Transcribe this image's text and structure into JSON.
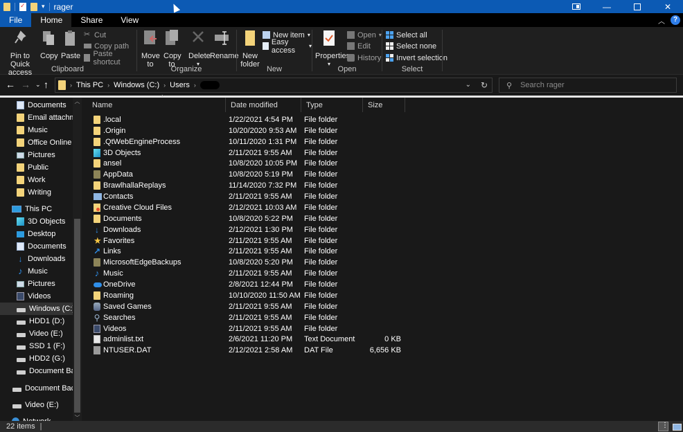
{
  "window": {
    "title": "rager",
    "controls": [
      "snap",
      "minimize",
      "maximize",
      "close"
    ]
  },
  "ribbon_tabs": [
    {
      "label": "File",
      "active": false
    },
    {
      "label": "Home",
      "active": true
    },
    {
      "label": "Share",
      "active": false
    },
    {
      "label": "View",
      "active": false
    }
  ],
  "ribbon": {
    "clipboard": {
      "label": "Clipboard",
      "pin": "Pin to Quick access",
      "pin_line1": "Pin to Quick",
      "pin_line2": "access",
      "copy": "Copy",
      "paste": "Paste",
      "cut": "Cut",
      "copy_path": "Copy path",
      "paste_shortcut": "Paste shortcut"
    },
    "organize": {
      "label": "Organize",
      "move_line1": "Move",
      "move_line2": "to",
      "copy_line1": "Copy",
      "copy_line2": "to",
      "delete": "Delete",
      "rename": "Rename"
    },
    "new": {
      "label": "New",
      "new_folder_line1": "New",
      "new_folder_line2": "folder",
      "new_item": "New item",
      "easy_access": "Easy access"
    },
    "open": {
      "label": "Open",
      "properties": "Properties",
      "open": "Open",
      "edit": "Edit",
      "history": "History"
    },
    "select": {
      "label": "Select",
      "select_all": "Select all",
      "select_none": "Select none",
      "invert_selection": "Invert selection"
    }
  },
  "address": {
    "breadcrumbs": [
      "This PC",
      "Windows (C:)",
      "Users"
    ],
    "search_placeholder": "Search rager"
  },
  "nav_pane": {
    "items": [
      {
        "label": "Documents",
        "icon": "documents"
      },
      {
        "label": "Email attachmer",
        "icon": "folder"
      },
      {
        "label": "Music",
        "icon": "folder"
      },
      {
        "label": "Office Online ex",
        "icon": "folder"
      },
      {
        "label": "Pictures",
        "icon": "pictures"
      },
      {
        "label": "Public",
        "icon": "folder"
      },
      {
        "label": "Work",
        "icon": "folder"
      },
      {
        "label": "Writing",
        "icon": "folder"
      },
      {
        "label": "This PC",
        "icon": "pc"
      },
      {
        "label": "3D Objects",
        "icon": "3d"
      },
      {
        "label": "Desktop",
        "icon": "desktop"
      },
      {
        "label": "Documents",
        "icon": "documents"
      },
      {
        "label": "Downloads",
        "icon": "downloads"
      },
      {
        "label": "Music",
        "icon": "music"
      },
      {
        "label": "Pictures",
        "icon": "pictures"
      },
      {
        "label": "Videos",
        "icon": "videos"
      },
      {
        "label": "Windows (C:)",
        "icon": "drive",
        "selected": true
      },
      {
        "label": "HDD1 (D:)",
        "icon": "drive"
      },
      {
        "label": "Video (E:)",
        "icon": "drive"
      },
      {
        "label": "SSD 1 (F:)",
        "icon": "drive"
      },
      {
        "label": "HDD2 (G:)",
        "icon": "drive"
      },
      {
        "label": "Document Back",
        "icon": "drive"
      },
      {
        "label": "Document Back U",
        "icon": "drive"
      },
      {
        "label": "Video (E:)",
        "icon": "drive"
      },
      {
        "label": "Network",
        "icon": "network"
      }
    ]
  },
  "file_list": {
    "columns": [
      "Name",
      "Date modified",
      "Type",
      "Size"
    ],
    "rows": [
      {
        "name": ".local",
        "date": "1/22/2021 4:54 PM",
        "type": "File folder",
        "size": "",
        "icon": "folder"
      },
      {
        "name": ".Origin",
        "date": "10/20/2020 9:53 AM",
        "type": "File folder",
        "size": "",
        "icon": "folder"
      },
      {
        "name": ".QtWebEngineProcess",
        "date": "10/11/2020 1:31 PM",
        "type": "File folder",
        "size": "",
        "icon": "folder"
      },
      {
        "name": "3D Objects",
        "date": "2/11/2021 9:55 AM",
        "type": "File folder",
        "size": "",
        "icon": "3d"
      },
      {
        "name": "ansel",
        "date": "10/8/2020 10:05 PM",
        "type": "File folder",
        "size": "",
        "icon": "folder"
      },
      {
        "name": "AppData",
        "date": "10/8/2020 5:19 PM",
        "type": "File folder",
        "size": "",
        "icon": "folder-hidden"
      },
      {
        "name": "BrawlhallaReplays",
        "date": "11/14/2020 7:32 PM",
        "type": "File folder",
        "size": "",
        "icon": "folder"
      },
      {
        "name": "Contacts",
        "date": "2/11/2021 9:55 AM",
        "type": "File folder",
        "size": "",
        "icon": "contacts"
      },
      {
        "name": "Creative Cloud Files",
        "date": "2/12/2021 10:03 AM",
        "type": "File folder",
        "size": "",
        "icon": "creative-cloud"
      },
      {
        "name": "Documents",
        "date": "10/8/2020 5:22 PM",
        "type": "File folder",
        "size": "",
        "icon": "folder"
      },
      {
        "name": "Downloads",
        "date": "2/12/2021 1:30 PM",
        "type": "File folder",
        "size": "",
        "icon": "downloads"
      },
      {
        "name": "Favorites",
        "date": "2/11/2021 9:55 AM",
        "type": "File folder",
        "size": "",
        "icon": "favorites"
      },
      {
        "name": "Links",
        "date": "2/11/2021 9:55 AM",
        "type": "File folder",
        "size": "",
        "icon": "links"
      },
      {
        "name": "MicrosoftEdgeBackups",
        "date": "10/8/2020 5:20 PM",
        "type": "File folder",
        "size": "",
        "icon": "folder-hidden"
      },
      {
        "name": "Music",
        "date": "2/11/2021 9:55 AM",
        "type": "File folder",
        "size": "",
        "icon": "music"
      },
      {
        "name": "OneDrive",
        "date": "2/8/2021 12:44 PM",
        "type": "File folder",
        "size": "",
        "icon": "onedrive"
      },
      {
        "name": "Roaming",
        "date": "10/10/2020 11:50 AM",
        "type": "File folder",
        "size": "",
        "icon": "folder"
      },
      {
        "name": "Saved Games",
        "date": "2/11/2021 9:55 AM",
        "type": "File folder",
        "size": "",
        "icon": "saved-games"
      },
      {
        "name": "Searches",
        "date": "2/11/2021 9:55 AM",
        "type": "File folder",
        "size": "",
        "icon": "searches"
      },
      {
        "name": "Videos",
        "date": "2/11/2021 9:55 AM",
        "type": "File folder",
        "size": "",
        "icon": "videos"
      },
      {
        "name": "adminlist.txt",
        "date": "2/6/2021 11:20 PM",
        "type": "Text Document",
        "size": "0 KB",
        "icon": "text-file"
      },
      {
        "name": "NTUSER.DAT",
        "date": "2/12/2021 2:58 AM",
        "type": "DAT File",
        "size": "6,656 KB",
        "icon": "dat-file"
      }
    ]
  },
  "status_bar": {
    "item_count": "22 items",
    "separator": "|"
  },
  "colors": {
    "titlebar": "#0c5ab4",
    "background": "#191919",
    "ribbon": "#1f1f1f",
    "folder": "#f3d37a",
    "accent_blue": "#2f8ee8"
  }
}
